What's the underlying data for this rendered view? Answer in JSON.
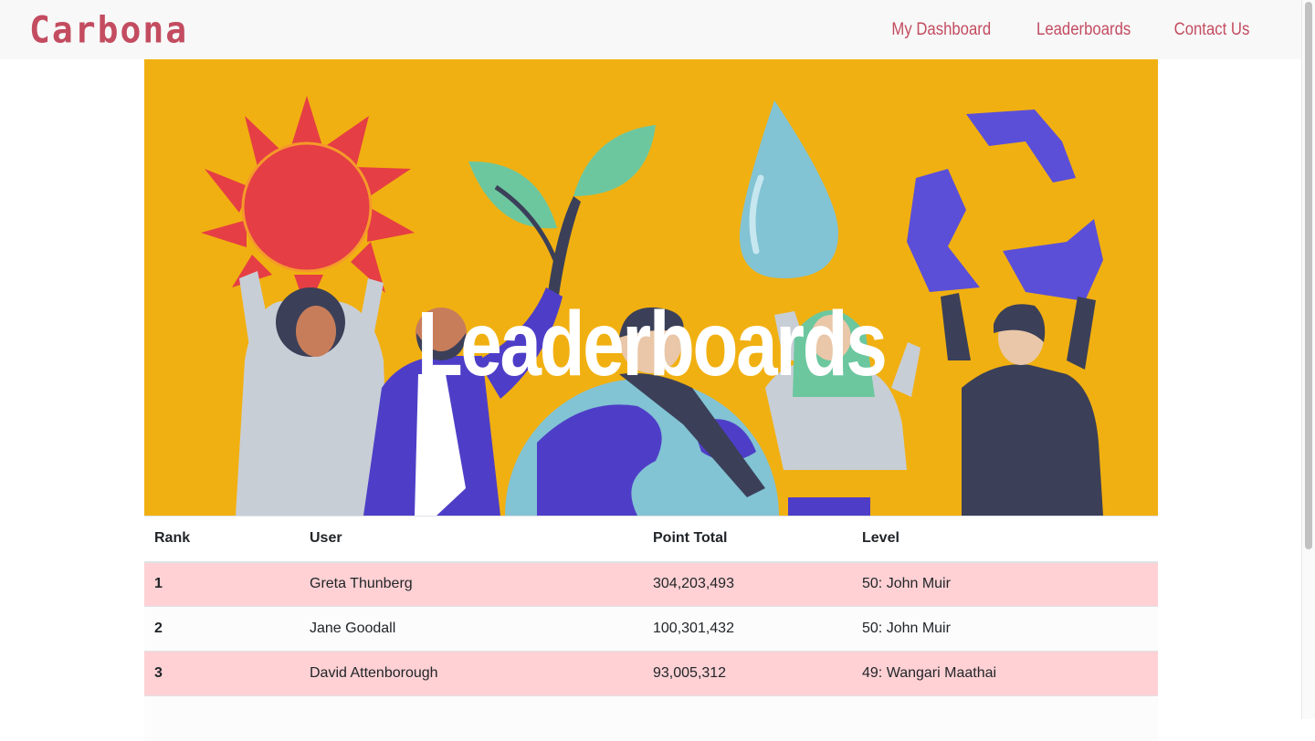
{
  "brand": {
    "name": "Carbona",
    "logo_icon": "heart-globe-icon",
    "color": "#c34c60"
  },
  "nav": {
    "items": [
      {
        "label": "My Dashboard"
      },
      {
        "label": "Leaderboards"
      },
      {
        "label": "Contact Us"
      }
    ]
  },
  "hero": {
    "title": "Leaderboards",
    "background": "#f1b011"
  },
  "table": {
    "headers": [
      "Rank",
      "User",
      "Point Total",
      "Level"
    ],
    "rows": [
      {
        "rank": "1",
        "user": "Greta Thunberg",
        "points": "304,203,493",
        "level": "50: John Muir"
      },
      {
        "rank": "2",
        "user": "Jane Goodall",
        "points": "100,301,432",
        "level": "50: John Muir"
      },
      {
        "rank": "3",
        "user": "David Attenborough",
        "points": "93,005,312",
        "level": "49: Wangari Maathai"
      }
    ],
    "stripe_color": "#ffd1d4"
  }
}
